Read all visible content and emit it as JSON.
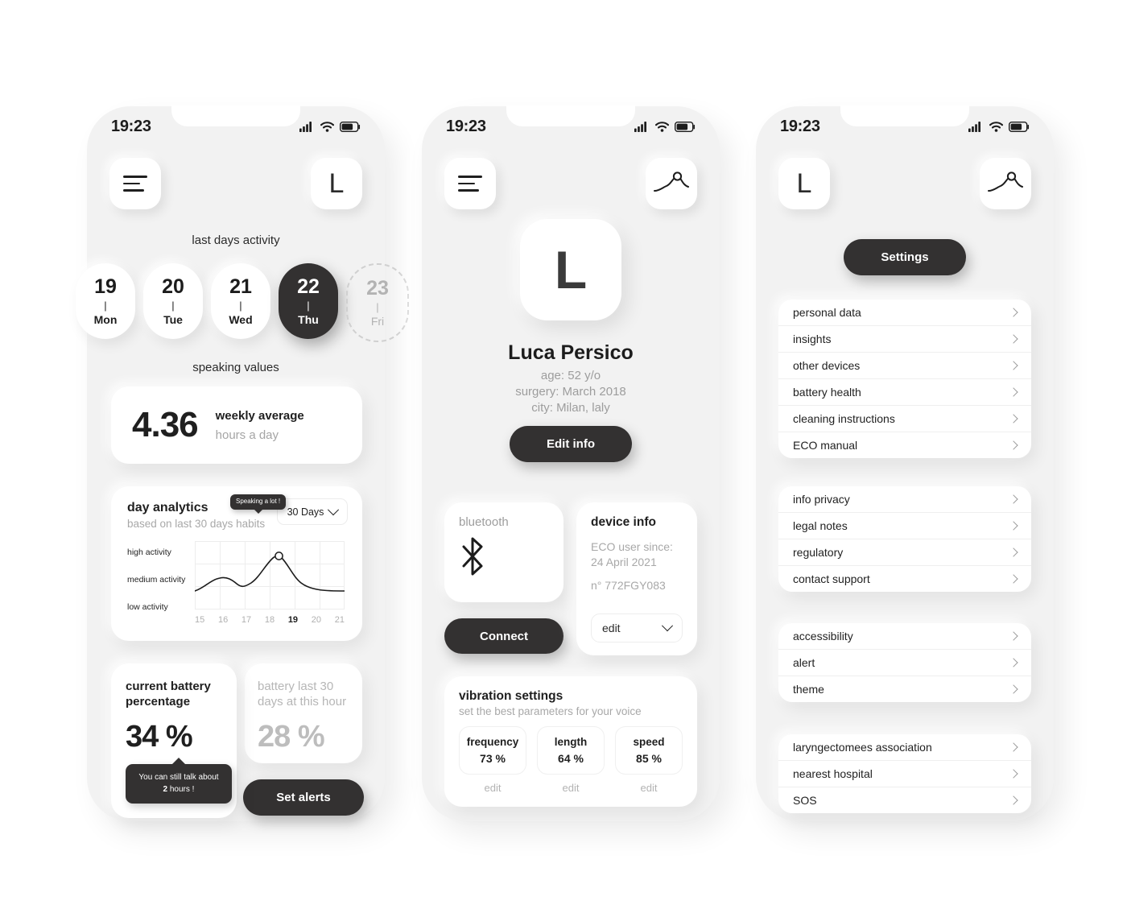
{
  "status_bar": {
    "time": "19:23",
    "signal_icon": "cellular-signal-icon",
    "wifi_icon": "wifi-icon",
    "battery_icon": "battery-icon"
  },
  "brand": {
    "logo_letter": "L"
  },
  "screen1": {
    "section_activity_title": "last days activity",
    "days": [
      {
        "num": "19",
        "sep": "|",
        "name": "Mon",
        "state": "normal"
      },
      {
        "num": "20",
        "sep": "|",
        "name": "Tue",
        "state": "normal"
      },
      {
        "num": "21",
        "sep": "|",
        "name": "Wed",
        "state": "normal"
      },
      {
        "num": "22",
        "sep": "|",
        "name": "Thu",
        "state": "active"
      },
      {
        "num": "23",
        "sep": "|",
        "name": "Fri",
        "state": "ghost"
      }
    ],
    "section_speaking_title": "speaking values",
    "weekly": {
      "value": "4.36",
      "label": "weekly average",
      "sublabel": "hours a day"
    },
    "analytics": {
      "title": "day analytics",
      "subtitle": "based on last 30 days habits",
      "range_selector": "30 Days",
      "tooltip": "Speaking a lot !"
    },
    "battery_current": {
      "title": "current battery percentage",
      "value": "34 %",
      "tooltip_line1": "You can still talk about",
      "tooltip_bold": "2",
      "tooltip_line2": " hours !"
    },
    "battery_past": {
      "title": "battery last 30 days at this hour",
      "value": "28 %"
    },
    "set_alerts_button": "Set alerts"
  },
  "screen2": {
    "avatar_letter": "L",
    "name": "Luca Persico",
    "age": "age: 52 y/o",
    "surgery": "surgery: March 2018",
    "city": "city: Milan, laly",
    "edit_info_button": "Edit info",
    "bluetooth": {
      "label": "bluetooth",
      "icon": "bluetooth-icon",
      "connect_button": "Connect"
    },
    "device_info": {
      "title": "device info",
      "since_label": "ECO user since:",
      "since_date": "24 April 2021",
      "serial": "n° 772FGY083",
      "edit_select": "edit"
    },
    "vibration": {
      "title": "vibration settings",
      "subtitle": "set the best parameters for your voice",
      "params": [
        {
          "key": "frequency",
          "value": "73 %",
          "edit": "edit"
        },
        {
          "key": "length",
          "value": "64 %",
          "edit": "edit"
        },
        {
          "key": "speed",
          "value": "85 %",
          "edit": "edit"
        }
      ]
    }
  },
  "screen3": {
    "settings_button": "Settings",
    "groups": [
      {
        "items": [
          "personal data",
          "insights",
          "other devices",
          "battery health",
          "cleaning instructions",
          "ECO manual"
        ]
      },
      {
        "items": [
          "info privacy",
          "legal notes",
          "regulatory",
          "contact support"
        ]
      },
      {
        "items": [
          "accessibility",
          "alert",
          "theme"
        ]
      },
      {
        "items": [
          "laryngectomees association",
          "nearest hospital",
          "SOS"
        ]
      }
    ]
  },
  "colors": {
    "background": "#ffffff",
    "phone_bg": "#f2f2f2",
    "card": "#ffffff",
    "dark": "#333131",
    "text": "#1f1f1f",
    "muted": "#a8a8a8"
  },
  "chart_data": {
    "type": "line",
    "title": "day analytics",
    "subtitle": "based on last 30 days habits",
    "xlabel": "",
    "ylabel": "",
    "x": [
      15,
      16,
      17,
      18,
      19,
      20,
      21
    ],
    "categories": [
      "15",
      "16",
      "17",
      "18",
      "19",
      "20",
      "21"
    ],
    "ytick_labels": [
      "high activity",
      "medium activity",
      "low activity"
    ],
    "ylim": [
      0,
      3
    ],
    "series": [
      {
        "name": "activity",
        "values": [
          0.85,
          1.55,
          1.35,
          1.6,
          2.45,
          1.4,
          0.85
        ]
      }
    ],
    "highlight_point": {
      "x": "19",
      "y": 2.45,
      "annotation": "Speaking a lot !"
    },
    "grid": true,
    "legend": "none",
    "current_x_tick": "19"
  }
}
